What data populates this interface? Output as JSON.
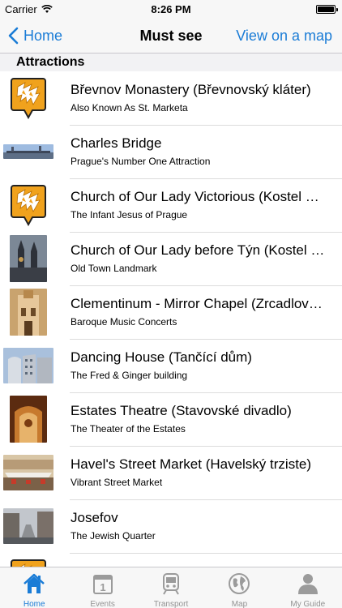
{
  "status_bar": {
    "carrier": "Carrier",
    "time": "8:26 PM"
  },
  "nav": {
    "back_label": "Home",
    "title": "Must see",
    "right_label": "View on a map"
  },
  "section": {
    "title": "Attractions"
  },
  "items": [
    {
      "title": "Břevnov Monastery (Břevnovský kláter)",
      "subtitle": "Also Known As St. Marketa",
      "thumb": "logo-icon"
    },
    {
      "title": "Charles Bridge",
      "subtitle": "Prague's Number One Attraction",
      "thumb": "photo-bridge"
    },
    {
      "title": "Church of Our Lady Victorious (Kostel Panny Marie Vítězné)",
      "subtitle": "The Infant Jesus of Prague",
      "thumb": "logo-icon"
    },
    {
      "title": "Church of Our Lady before Týn (Kostel Matky Boží před Týnem)",
      "subtitle": "Old Town Landmark",
      "thumb": "photo-tyn"
    },
    {
      "title": "Clementinum - Mirror Chapel (Zrcadlová kaple)",
      "subtitle": "Baroque Music Concerts",
      "thumb": "photo-clementinum"
    },
    {
      "title": "Dancing House (Tančící dům)",
      "subtitle": "The Fred & Ginger building",
      "thumb": "photo-dancing"
    },
    {
      "title": "Estates Theatre (Stavovské divadlo)",
      "subtitle": "The Theater of the Estates",
      "thumb": "photo-theatre"
    },
    {
      "title": "Havel's Street Market (Havelský trziste)",
      "subtitle": "Vibrant Street Market",
      "thumb": "photo-market"
    },
    {
      "title": "Josefov",
      "subtitle": "The Jewish Quarter",
      "thumb": "photo-josefov"
    },
    {
      "title": "",
      "subtitle": "",
      "thumb": "logo-icon"
    }
  ],
  "tabs": [
    {
      "label": "Home",
      "icon": "home-icon",
      "active": true
    },
    {
      "label": "Events",
      "icon": "calendar-icon",
      "active": false
    },
    {
      "label": "Transport",
      "icon": "train-icon",
      "active": false
    },
    {
      "label": "Map",
      "icon": "globe-icon",
      "active": false
    },
    {
      "label": "My Guide",
      "icon": "person-icon",
      "active": false
    }
  ],
  "colors": {
    "accent": "#1a7cd6",
    "logo_orange": "#f0a21d",
    "tab_inactive": "#929292"
  }
}
